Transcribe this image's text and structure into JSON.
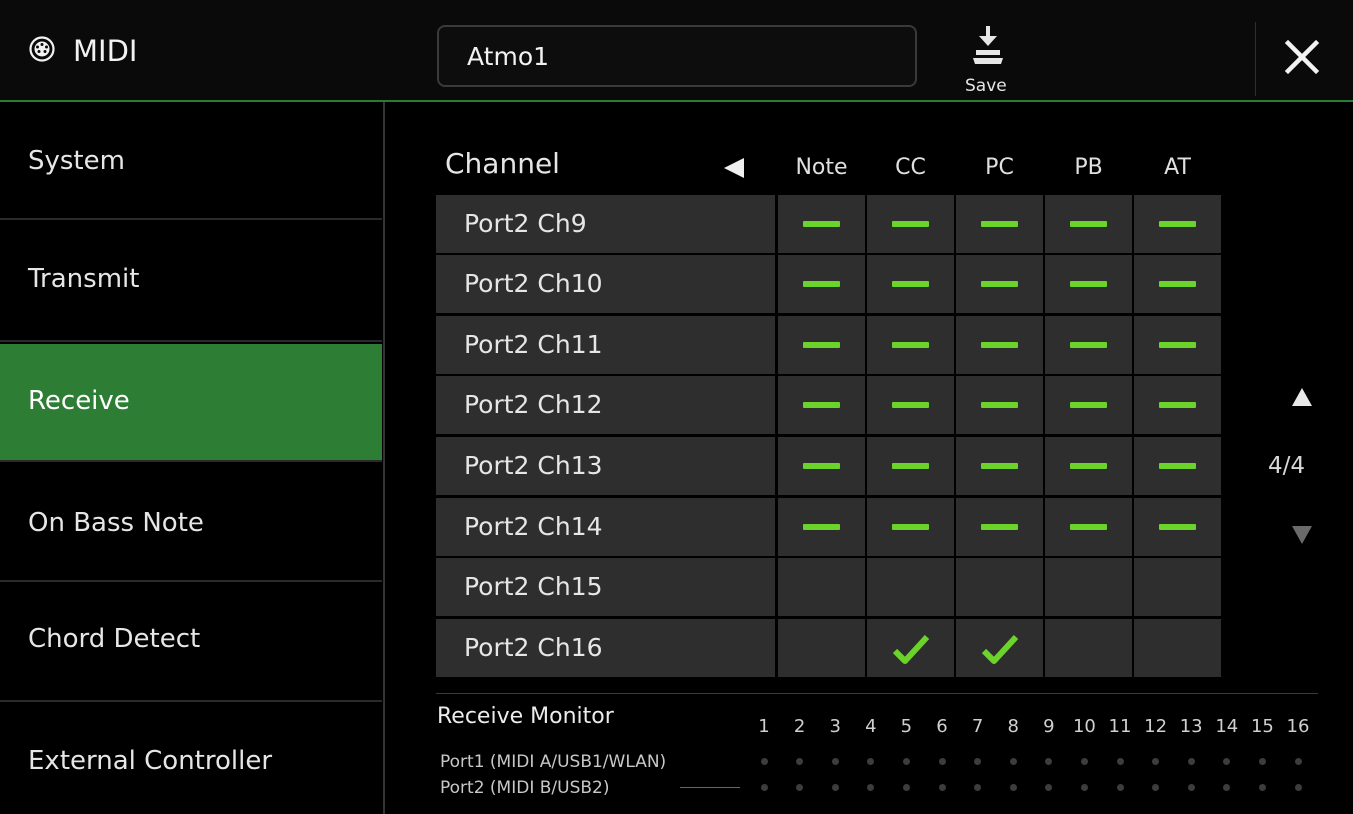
{
  "header": {
    "app_icon": "midi-connector-icon",
    "title": "MIDI",
    "setting_name": "Atmo1",
    "save_label": "Save",
    "save_icon": "save-download-icon",
    "close_icon": "close-x-icon"
  },
  "sidebar": {
    "items": [
      {
        "label": "System",
        "active": false
      },
      {
        "label": "Transmit",
        "active": false
      },
      {
        "label": "Receive",
        "active": true
      },
      {
        "label": "On Bass Note",
        "active": false
      },
      {
        "label": "Chord Detect",
        "active": false
      },
      {
        "label": "External Controller",
        "active": false
      }
    ]
  },
  "grid": {
    "channel_header": "Channel",
    "columns": [
      "Note",
      "CC",
      "PC",
      "PB",
      "AT"
    ],
    "rows": [
      {
        "label": "Port2 Ch9",
        "cells": [
          "dash",
          "dash",
          "dash",
          "dash",
          "dash"
        ]
      },
      {
        "label": "Port2 Ch10",
        "cells": [
          "dash",
          "dash",
          "dash",
          "dash",
          "dash"
        ]
      },
      {
        "label": "Port2 Ch11",
        "cells": [
          "dash",
          "dash",
          "dash",
          "dash",
          "dash"
        ]
      },
      {
        "label": "Port2 Ch12",
        "cells": [
          "dash",
          "dash",
          "dash",
          "dash",
          "dash"
        ]
      },
      {
        "label": "Port2 Ch13",
        "cells": [
          "dash",
          "dash",
          "dash",
          "dash",
          "dash"
        ]
      },
      {
        "label": "Port2 Ch14",
        "cells": [
          "dash",
          "dash",
          "dash",
          "dash",
          "dash"
        ]
      },
      {
        "label": "Port2 Ch15",
        "cells": [
          "off",
          "off",
          "off",
          "off",
          "off"
        ]
      },
      {
        "label": "Port2 Ch16",
        "cells": [
          "off",
          "check",
          "check",
          "off",
          "off"
        ]
      }
    ]
  },
  "pager": {
    "text": "4/4",
    "up_icon": "triangle-up-icon",
    "down_icon": "triangle-down-icon"
  },
  "monitor": {
    "title": "Receive Monitor",
    "channel_numbers": [
      "1",
      "2",
      "3",
      "4",
      "5",
      "6",
      "7",
      "8",
      "9",
      "10",
      "11",
      "12",
      "13",
      "14",
      "15",
      "16"
    ],
    "ports": [
      {
        "label": "Port1 (MIDI A/USB1/WLAN)"
      },
      {
        "label": "Port2 (MIDI B/USB2)"
      }
    ]
  },
  "colors": {
    "accent_green": "#2e7d35",
    "indicator_green": "#6cd32a",
    "cell_bg": "#2e2e2e"
  }
}
